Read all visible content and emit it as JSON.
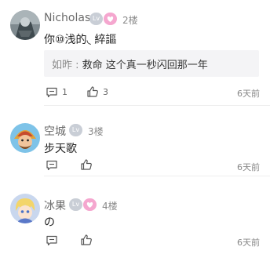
{
  "comments": [
    {
      "username": "Nicholas",
      "level_badge": "Lv",
      "floor": "2楼",
      "content": "你⑩浅的◟  綷謳",
      "reply": {
        "author": "如昨",
        "separator": " : ",
        "text": "救命 这个真一秒闪回那一年"
      },
      "comment_count": "1",
      "like_count": "3",
      "time": "6天前"
    },
    {
      "username": "空城",
      "level_badge": "Lv",
      "floor": "3楼",
      "content": "步天歌",
      "time": "6天前"
    },
    {
      "username": "冰果",
      "level_badge": "Lv",
      "floor": "4楼",
      "content": "の",
      "time": "6天前"
    }
  ],
  "icons": {
    "comment": "comment-icon",
    "like": "thumbs-up-icon",
    "pink_badge": "heart-badge-icon"
  },
  "colors": {
    "badge_gray": "#c9ced6",
    "badge_pink": "#f5a7cf",
    "reply_bg": "#f4f4f6"
  }
}
